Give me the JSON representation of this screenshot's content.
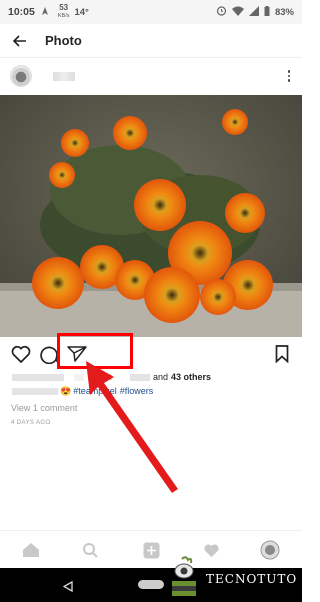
{
  "status_bar": {
    "time": "10:05",
    "net_speed": "53",
    "net_unit": "KB/s",
    "temperature": "14°",
    "battery": "83%"
  },
  "app_bar": {
    "title": "Photo",
    "back_icon": "arrow-left-icon"
  },
  "post": {
    "likes_text": "and",
    "likes_others": "43 others",
    "liked_by_prefix": "guest",
    "caption_emoji": "😍",
    "caption_tag_1": "#teampixel",
    "caption_tag_2": "#flowers",
    "view_comments": "View 1 comment",
    "time_ago": "4 DAYS AGO"
  },
  "icons": {
    "like": "heart-icon",
    "comment": "comment-icon",
    "share": "send-icon",
    "save": "bookmark-icon",
    "more": "more-vertical-icon"
  },
  "bottom_nav": [
    {
      "name": "home-icon"
    },
    {
      "name": "search-icon"
    },
    {
      "name": "add-icon"
    },
    {
      "name": "activity-heart-icon"
    },
    {
      "name": "profile-icon"
    }
  ],
  "watermark": {
    "text": "TECNOTUTO"
  },
  "colors": {
    "highlight": "#ff0000",
    "hashtag": "#1f4e8a"
  }
}
